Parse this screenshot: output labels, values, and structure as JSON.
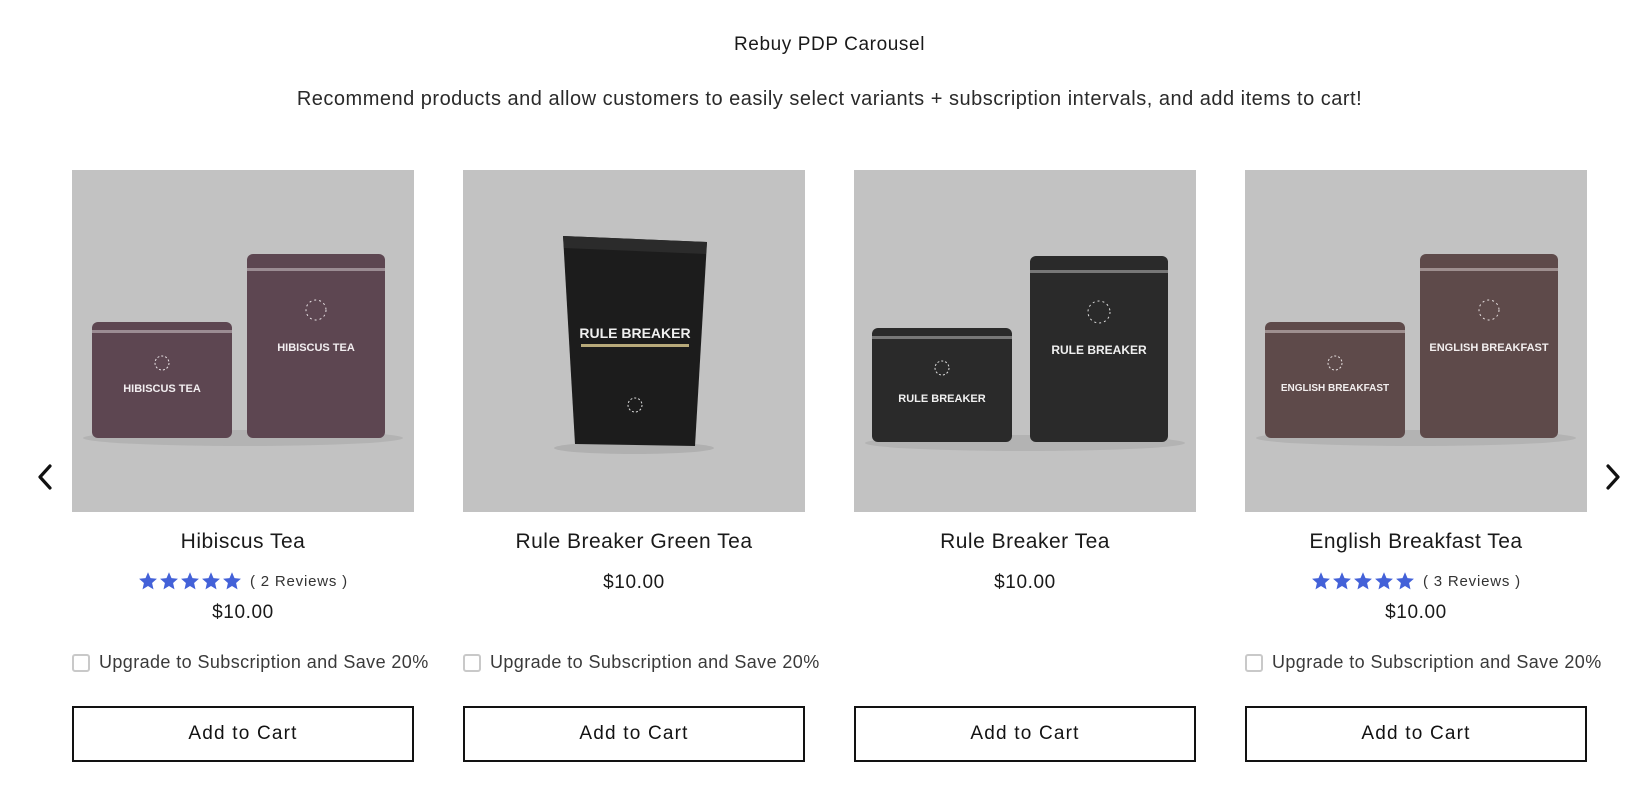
{
  "header": {
    "title": "Rebuy PDP Carousel",
    "subtitle": "Recommend products and allow customers to easily select variants + subscription intervals, and add items to cart!"
  },
  "carousel": {
    "prev_icon": "chevron-left-icon",
    "next_icon": "chevron-right-icon",
    "products": [
      {
        "name": "Hibiscus Tea",
        "image_label": "HIBISCUS TEA",
        "rating_stars": 5,
        "reviews": "( 2 Reviews )",
        "price": "$10.00",
        "subscription_label": "Upgrade to Subscription and Save 20%",
        "button_label": "Add to Cart",
        "tin_color": "#5d4651"
      },
      {
        "name": "Rule Breaker Green Tea",
        "image_label": "RULE BREAKER",
        "price": "$10.00",
        "subscription_label": "Upgrade to Subscription and Save 20%",
        "button_label": "Add to Cart",
        "tin_color": "#1c1c1c"
      },
      {
        "name": "Rule Breaker Tea",
        "image_label": "RULE BREAKER",
        "price": "$10.00",
        "button_label": "Add to Cart",
        "tin_color": "#2a2a2a"
      },
      {
        "name": "English Breakfast Tea",
        "image_label": "ENGLISH BREAKFAST",
        "rating_stars": 5,
        "reviews": "( 3 Reviews )",
        "price": "$10.00",
        "subscription_label": "Upgrade to Subscription and Save 20%",
        "button_label": "Add to Cart",
        "tin_color": "#5e4a4a"
      }
    ]
  },
  "colors": {
    "star": "#4361d8",
    "image_bg": "#c2c2c2",
    "button_border": "#121212"
  }
}
